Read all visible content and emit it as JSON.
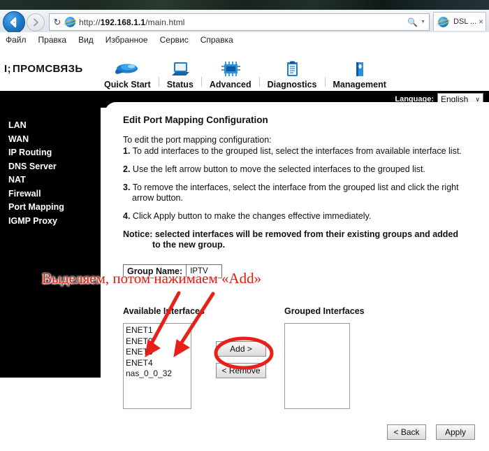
{
  "browser": {
    "back_icon": "back-arrow-icon",
    "forward_icon": "forward-arrow-icon",
    "refresh_icon": "refresh-icon",
    "site_icon": "internet-explorer-icon",
    "url_prefix": "http://",
    "url_host": "192.168.1.1",
    "url_path": "/main.html",
    "search_icon": "search-icon",
    "dropdown_caret": "caret-down-icon",
    "tab_title": "DSL ...",
    "tab_close": "×"
  },
  "menubar": {
    "items": [
      "Файл",
      "Правка",
      "Вид",
      "Избранное",
      "Сервис",
      "Справка"
    ]
  },
  "router": {
    "logo": "ПРОМСВЯЗЬ",
    "nav": [
      {
        "label": "Quick Start",
        "icon": "rocket-icon"
      },
      {
        "label": "Status",
        "icon": "monitor-icon"
      },
      {
        "label": "Advanced",
        "icon": "chip-icon"
      },
      {
        "label": "Diagnostics",
        "icon": "clipboard-icon"
      },
      {
        "label": "Management",
        "icon": "book-icon"
      }
    ],
    "language": {
      "label": "Language:",
      "value": "English",
      "chevron": "∨"
    },
    "sidebar": {
      "items": [
        "LAN",
        "WAN",
        "IP Routing",
        "DNS Server",
        "NAT",
        "Firewall",
        "Port Mapping",
        "IGMP Proxy"
      ],
      "active": "Port Mapping"
    }
  },
  "page": {
    "title": "Edit Port Mapping Configuration",
    "intro": "To edit the port mapping configuration:",
    "steps": [
      {
        "num": "1.",
        "text": "To add interfaces to the grouped list, select the interfaces from available interface list.",
        "cont": ""
      },
      {
        "num": "2.",
        "text": "Use the left arrow button to move the selected interfaces to the grouped list.",
        "cont": ""
      },
      {
        "num": "3.",
        "text": "To remove the interfaces, select the interface from the grouped list and click the right",
        "cont": "arrow button."
      },
      {
        "num": "4.",
        "text": "Click Apply button to make the changes effective immediately.",
        "cont": ""
      }
    ],
    "notice": {
      "label": "Notice:",
      "line1": "selected interfaces will be removed from their existing groups and added",
      "line2": "to the new group."
    },
    "group_name": {
      "label": "Group Name:",
      "value": "IPTV"
    },
    "available": {
      "label": "Available Interfaces",
      "items": [
        "ENET1",
        "ENET2",
        "ENET3",
        "ENET4",
        "nas_0_0_32"
      ]
    },
    "grouped": {
      "label": "Grouped Interfaces",
      "items": []
    },
    "buttons": {
      "add": "Add  >",
      "remove": "<  Remove",
      "back": "<  Back",
      "apply": "Apply"
    }
  },
  "annotations": {
    "note_text": "Выделяем, потом нажимаем «Add»",
    "color": "#e01b12",
    "marks": [
      "arrow-to-available-list",
      "arrow-to-available-list",
      "circle-around-add-button"
    ]
  }
}
